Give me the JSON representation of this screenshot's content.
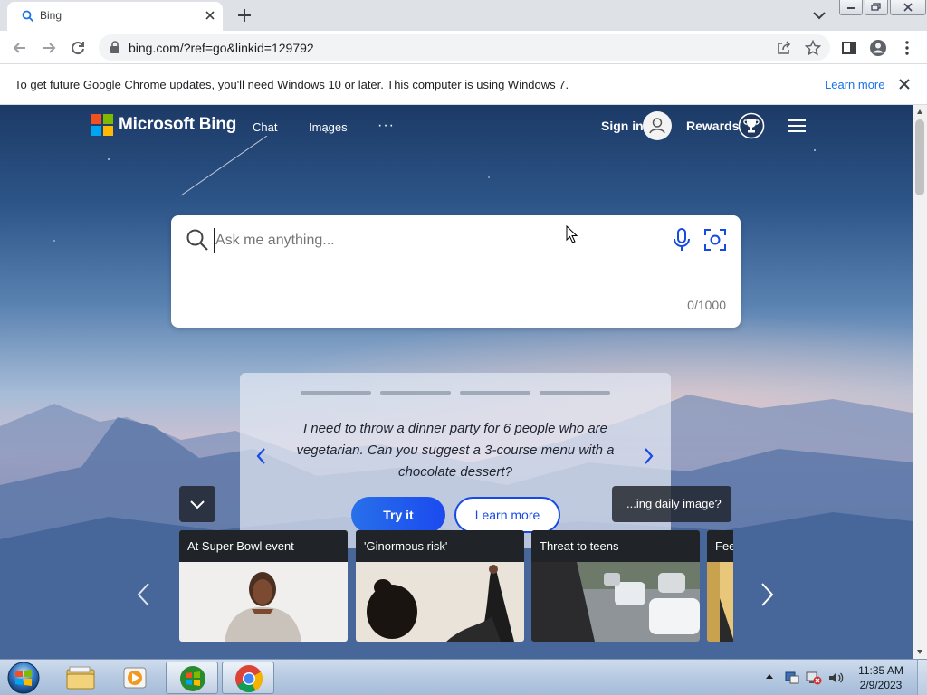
{
  "browser": {
    "tab_title": "Bing",
    "url": "bing.com/?ref=go&linkid=129792"
  },
  "infobar": {
    "message": "To get future Google Chrome updates, you'll need Windows 10 or later. This computer is using Windows 7.",
    "link": "Learn more"
  },
  "bing": {
    "brand": "Microsoft Bing",
    "nav": {
      "chat": "Chat",
      "images": "Images",
      "more": "···"
    },
    "signin": "Sign in",
    "rewards": "Rewards",
    "search": {
      "placeholder": "Ask me anything...",
      "char_count": "0/1000"
    },
    "prompt": {
      "text": "I need to throw a dinner party for 6 people who are vegetarian. Can you suggest a 3-course menu with a chocolate dessert?",
      "try_label": "Try it",
      "learn_label": "Learn more"
    },
    "image_pill": "...ing daily image?",
    "cards": [
      {
        "title": "At Super Bowl event"
      },
      {
        "title": "'Ginormous risk'"
      },
      {
        "title": "Threat to teens"
      },
      {
        "title": "Fee"
      }
    ],
    "colors": {
      "accent": "#174ae4",
      "logo": [
        "#f25022",
        "#7fba00",
        "#00a4ef",
        "#ffb900"
      ]
    }
  },
  "taskbar": {
    "time": "11:35 AM",
    "date": "2/9/2023",
    "apps": [
      "explorer-icon",
      "media-player-icon",
      "windows-media-icon",
      "chrome-icon"
    ]
  }
}
